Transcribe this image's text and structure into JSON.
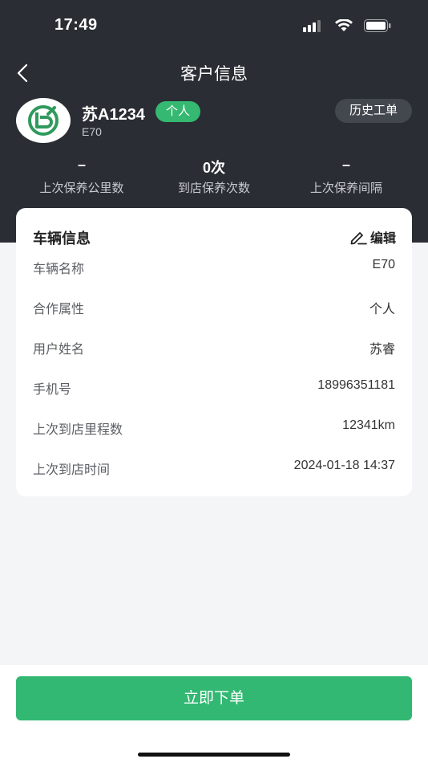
{
  "status_bar": {
    "time": "17:49"
  },
  "nav": {
    "title": "客户信息"
  },
  "profile": {
    "plate": "苏A1234",
    "tag": "个人",
    "model": "E70",
    "history_button": "历史工单"
  },
  "stats": [
    {
      "value": "–",
      "label": "上次保养公里数"
    },
    {
      "value": "0次",
      "label": "到店保养次数"
    },
    {
      "value": "–",
      "label": "上次保养间隔"
    }
  ],
  "vehicle_card": {
    "title": "车辆信息",
    "edit_label": "编辑",
    "rows": [
      {
        "label": "车辆名称",
        "value": "E70"
      },
      {
        "label": "合作属性",
        "value": "个人"
      },
      {
        "label": "用户姓名",
        "value": "苏睿"
      },
      {
        "label": "手机号",
        "value": "18996351181"
      },
      {
        "label": "上次到店里程数",
        "value": "12341km"
      },
      {
        "label": "上次到店时间",
        "value": "2024-01-18 14:37"
      }
    ]
  },
  "footer": {
    "order_button": "立即下单"
  },
  "colors": {
    "header_bg": "#2a2d33",
    "accent_green": "#32b872",
    "page_bg": "#f4f5f7"
  }
}
